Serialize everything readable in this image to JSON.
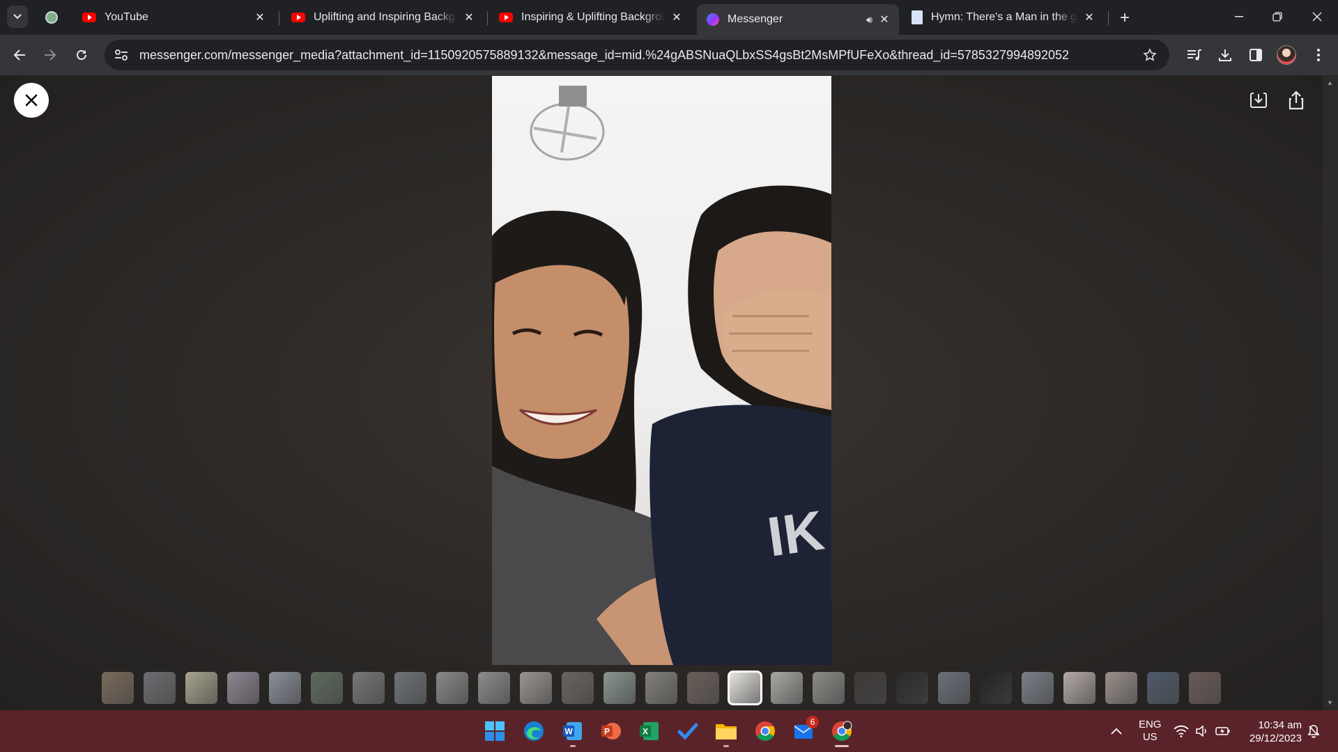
{
  "browser": {
    "tabs": [
      {
        "title": "YouTube",
        "favicon": "youtube-icon",
        "active": false
      },
      {
        "title": "Uplifting and Inspiring Backgro",
        "favicon": "youtube-icon",
        "active": false
      },
      {
        "title": "Inspiring & Uplifting Backgroun",
        "favicon": "youtube-icon",
        "active": false
      },
      {
        "title": "Messenger",
        "favicon": "messenger-icon",
        "active": true,
        "audio": true
      },
      {
        "title": "Hymn: There's a Man in the glo",
        "favicon": "document-icon",
        "active": false
      }
    ],
    "new_tab_label": "+",
    "url": "messenger.com/messenger_media?attachment_id=1150920575889132&message_id=mid.%24gABSNuaQLbxSS4gsBt2MsMPfUFeXo&thread_id=5785327994892052"
  },
  "viewer": {
    "thumbnail_count": 27,
    "selected_thumbnail_index": 15,
    "thumbnail_colors": [
      "#7a6a5a",
      "#6e6e72",
      "#a9a48e",
      "#8e8592",
      "#8a8f9a",
      "#5d6a5c",
      "#77777a",
      "#6f7378",
      "#88888a",
      "#8c8c8c",
      "#9a9592",
      "#6a6460",
      "#8a9690",
      "#83807a",
      "#6a5e58",
      "#e8e6e2",
      "#a9a8a4",
      "#8d8c88",
      "#3e3a38",
      "#2a2a2a",
      "#6a6f78",
      "#232323",
      "#7a8088",
      "#b4aaa6",
      "#9a908a",
      "#4e5a6a",
      "#6a5a56"
    ]
  },
  "taskbar": {
    "apps": [
      {
        "name": "windows-start-icon"
      },
      {
        "name": "edge-icon"
      },
      {
        "name": "word-icon"
      },
      {
        "name": "powerpoint-icon"
      },
      {
        "name": "excel-icon"
      },
      {
        "name": "todo-icon"
      },
      {
        "name": "file-explorer-icon"
      },
      {
        "name": "chrome-icon"
      },
      {
        "name": "mail-icon",
        "badge": "6"
      },
      {
        "name": "chrome-profile-icon"
      }
    ],
    "language_line1": "ENG",
    "language_line2": "US",
    "time": "10:34 am",
    "date": "29/12/2023"
  },
  "colors": {
    "taskbar": "#5a2329",
    "tabstrip": "#202124",
    "toolbar": "#35363a"
  }
}
